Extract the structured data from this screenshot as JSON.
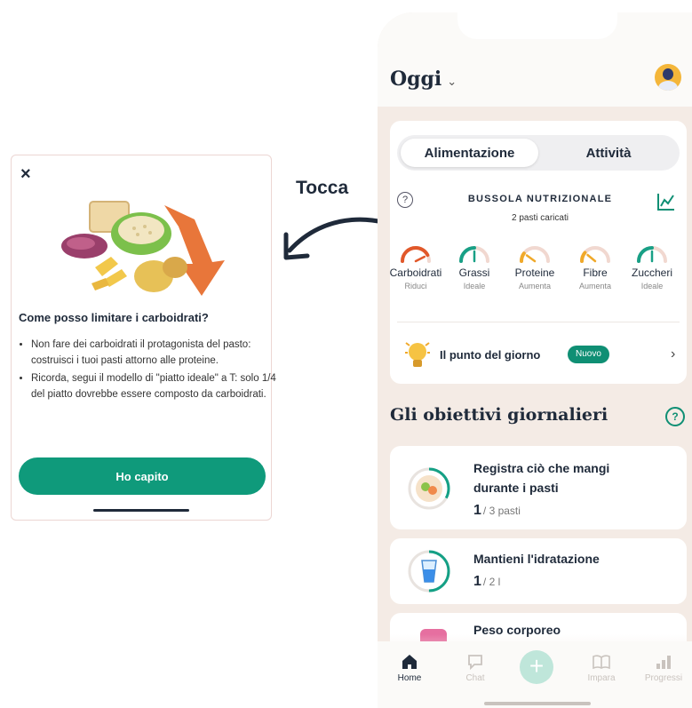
{
  "annotation": {
    "label": "Tocca"
  },
  "modal": {
    "close": "×",
    "title": "Come posso limitare i carboidrati?",
    "bullets": [
      "Non fare dei carboidrati il protagonista del pasto: costruisci i tuoi pasti attorno alle proteine.",
      "Ricorda, segui il modello di \"piatto ideale\" a T: solo 1/4 del piatto dovrebbe essere composto da carboidrati."
    ],
    "button": "Ho capito"
  },
  "header": {
    "title": "Oggi",
    "chevron": "⌄"
  },
  "segment": {
    "tabs": [
      "Alimentazione",
      "Attività"
    ],
    "active": 0
  },
  "compass": {
    "help": "?",
    "title": "BUSSOLA NUTRIZIONALE",
    "subtitle": "2 pasti caricati",
    "gauges": [
      {
        "name": "Carboidrati",
        "status": "Riduci",
        "level": 0.85,
        "color": "#e1582a"
      },
      {
        "name": "Grassi",
        "status": "Ideale",
        "level": 0.5,
        "color": "#18a086"
      },
      {
        "name": "Proteine",
        "status": "Aumenta",
        "level": 0.2,
        "color": "#f0a92a"
      },
      {
        "name": "Fibre",
        "status": "Aumenta",
        "level": 0.22,
        "color": "#f0a92a"
      },
      {
        "name": "Zuccheri",
        "status": "Ideale",
        "level": 0.5,
        "color": "#18a086"
      }
    ]
  },
  "tip": {
    "label": "Il punto del giorno",
    "badge": "Nuovo",
    "chevron": "›"
  },
  "goals": {
    "title": "Gli obiettivi giornalieri",
    "help": "?",
    "items": [
      {
        "title_line1": "Registra ciò che mangi",
        "title_line2": "durante i pasti",
        "count": "1",
        "total": "/ 3 pasti",
        "progress": 0.33
      },
      {
        "title_line1": "Mantieni l'idratazione",
        "count": "1",
        "total": "/ 2 l",
        "progress": 0.5
      },
      {
        "title_line1": "Peso corporeo"
      }
    ]
  },
  "tabbar": {
    "items": [
      {
        "label": "Home",
        "icon": "home-icon"
      },
      {
        "label": "Chat",
        "icon": "chat-icon"
      },
      {
        "label": "+",
        "icon": "plus-icon"
      },
      {
        "label": "Impara",
        "icon": "book-icon"
      },
      {
        "label": "Progressi",
        "icon": "bars-icon"
      }
    ]
  }
}
